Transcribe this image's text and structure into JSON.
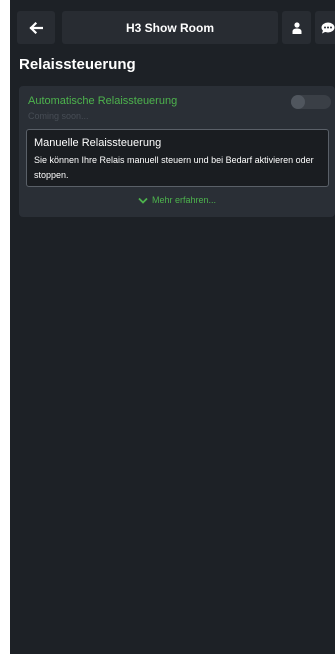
{
  "header": {
    "title": "H3 Show Room",
    "back_icon": "arrow-left-icon",
    "user_icon": "user-icon",
    "chat_icon": "chat-bubble-icon"
  },
  "page": {
    "title": "Relaissteuerung"
  },
  "card": {
    "auto_label": "Automatische Relaissteuerung",
    "auto_status": "Coming soon...",
    "toggle_on": false,
    "manual_title": "Manuelle Relaissteuerung",
    "manual_description": "Sie können Ihre Relais manuell steuern und bei Bedarf aktivieren oder stoppen.",
    "more_label": "Mehr erfahren...",
    "more_icon": "chevron-down-icon"
  },
  "colors": {
    "accent": "#4db34d",
    "background": "#1d2126",
    "card": "#2a2f36"
  }
}
